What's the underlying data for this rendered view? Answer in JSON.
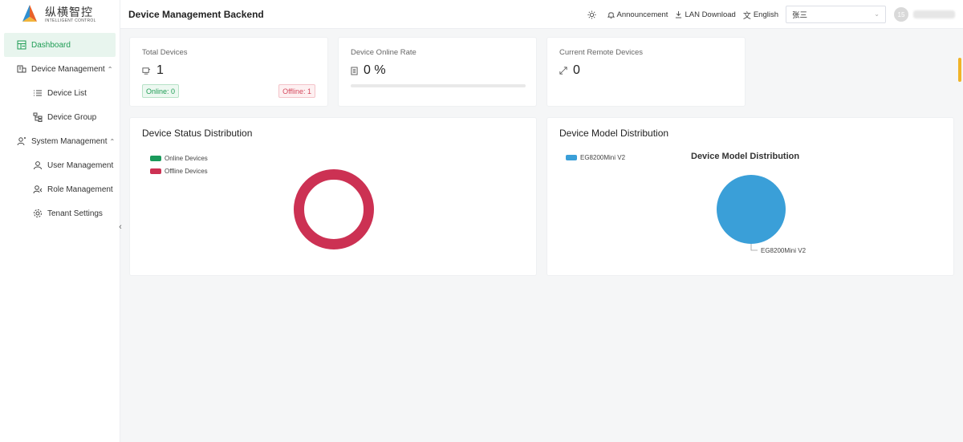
{
  "app": {
    "logo_cn": "纵横智控",
    "logo_en": "INTELLIGENT CONTROL",
    "title": "Device Management Backend"
  },
  "sidebar": {
    "items": [
      {
        "label": "Dashboard",
        "icon": "dashboard-icon"
      },
      {
        "label": "Device Management",
        "icon": "device-management-icon"
      },
      {
        "label": "Device List",
        "icon": "list-icon"
      },
      {
        "label": "Device Group",
        "icon": "group-icon"
      },
      {
        "label": "System Management",
        "icon": "system-icon"
      },
      {
        "label": "User Management",
        "icon": "user-icon"
      },
      {
        "label": "Role Management",
        "icon": "role-icon"
      },
      {
        "label": "Tenant Settings",
        "icon": "gear-icon"
      }
    ]
  },
  "header": {
    "announcement": "Announcement",
    "lan_download": "LAN Download",
    "language": "English",
    "tenant": "张三",
    "avatar_text": "15"
  },
  "stats": {
    "total_devices_label": "Total Devices",
    "total_devices": "1",
    "online_tag": "Online: 0",
    "offline_tag": "Offline: 1",
    "online_rate_label": "Device Online Rate",
    "online_rate": "0 %",
    "online_rate_fraction": 0,
    "remote_label": "Current Remote Devices",
    "remote_value": "0"
  },
  "status_chart": {
    "title": "Device Status Distribution"
  },
  "model_chart": {
    "title": "Device Model Distribution",
    "inner_title": "Device Model Distribution"
  },
  "colors": {
    "accent": "#1f9d55",
    "online": "#1a9a5b",
    "offline": "#cc3153",
    "model": "#3a9fd8"
  },
  "chart_data": [
    {
      "type": "pie",
      "variant": "donut",
      "categories": [
        "Online Devices",
        "Offline Devices"
      ],
      "values": [
        0,
        1
      ],
      "colors": [
        "#1a9a5b",
        "#cc3153"
      ],
      "legend": "top-left"
    },
    {
      "type": "pie",
      "title": "Device Model Distribution",
      "categories": [
        "EG8200Mini V2"
      ],
      "values": [
        1
      ],
      "colors": [
        "#3a9fd8"
      ],
      "legend": "top-left"
    }
  ]
}
